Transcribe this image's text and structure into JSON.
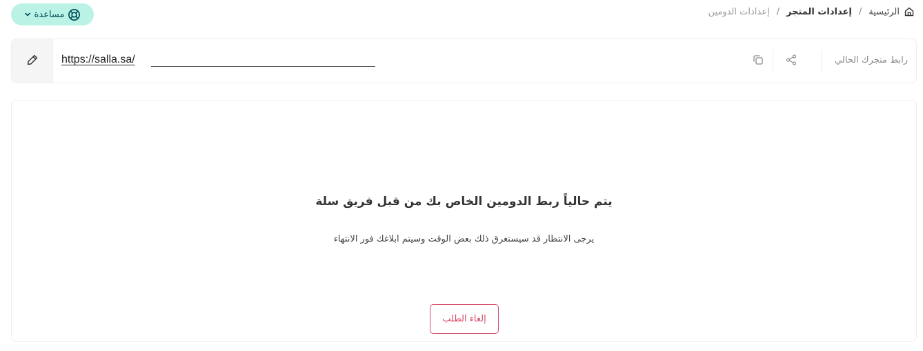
{
  "breadcrumb": {
    "home": "الرئيسية",
    "store_settings": "إعدادات المتجر",
    "current": "إعدادات الدومين",
    "separator": "/"
  },
  "help": {
    "label": "مساعدة",
    "icon": "lifebuoy-icon",
    "chevron": "chevron-down-icon"
  },
  "store_link": {
    "label": "رابط متجرك الحالي",
    "url": "https://salla.sa/",
    "actions": [
      "share-icon",
      "copy-icon",
      "edit-icon"
    ]
  },
  "status": {
    "heading": "يتم حالياً ربط الدومين الخاص بك من قبل فريق سلة",
    "message": "يرجى الانتظار قد سيستغرق ذلك بعض الوقت وسيتم ابلاغك فور الانتهاء",
    "cancel_label": "إلغاء الطلب"
  },
  "colors": {
    "help_bg": "#baf3e6",
    "help_text": "#004d5a",
    "cancel_border": "#d44a6a"
  }
}
